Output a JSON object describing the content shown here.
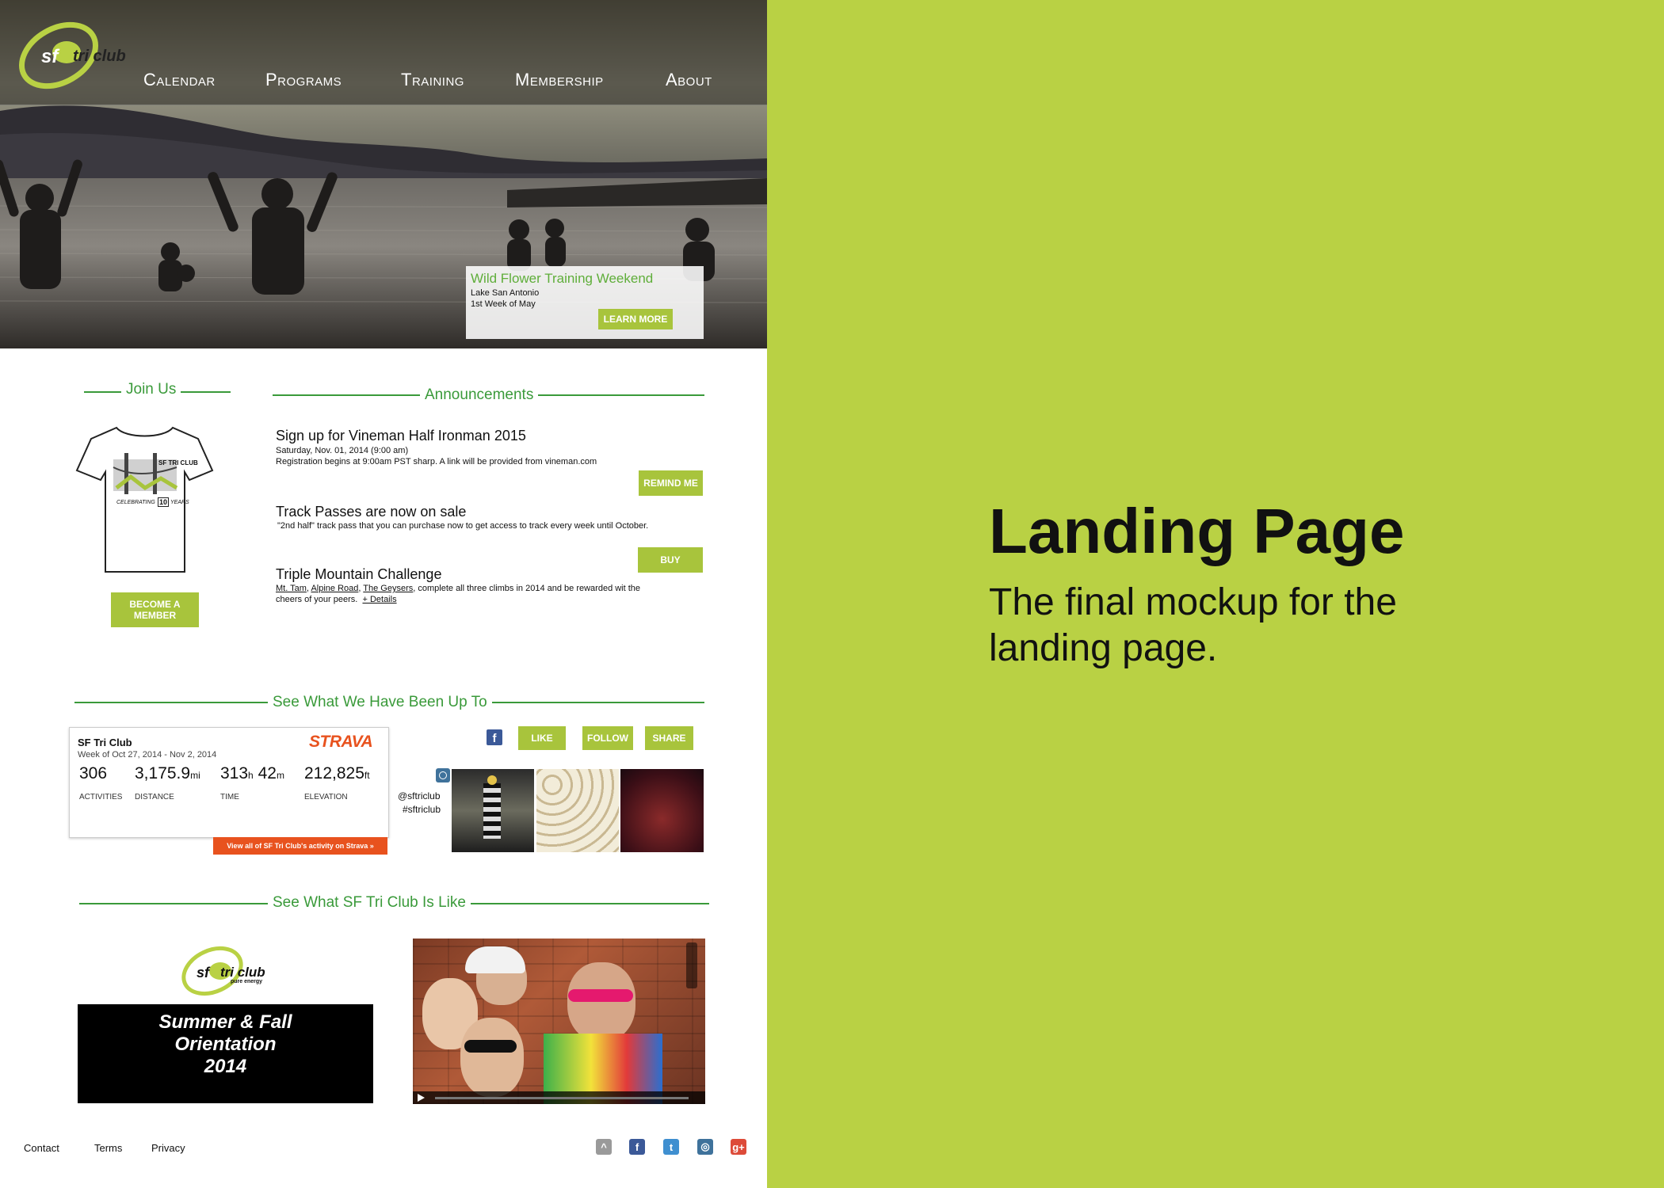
{
  "nav": {
    "logo_text": "tri club",
    "logo_sf": "sf",
    "items": [
      "Calendar",
      "Programs",
      "Training",
      "Membership",
      "About"
    ]
  },
  "hero_card": {
    "title": "Wild Flower Training Weekend",
    "line1": "Lake San Antonio",
    "line2": "1st Week of May",
    "button": "LEARN MORE"
  },
  "join": {
    "title": "Join Us",
    "shirt_title": "SF TRI CLUB",
    "shirt_caption_a": "CELEBRATING",
    "shirt_years": "10",
    "shirt_caption_b": "YEARS",
    "button_line1": "BECOME A",
    "button_line2": "MEMBER"
  },
  "announcements": {
    "title": "Announcements",
    "items": [
      {
        "title": "Sign up for Vineman Half Ironman 2015",
        "line1": "Saturday, Nov. 01, 2014 (9:00 am)",
        "line2": "Registration begins at 9:00am PST sharp. A link will be provided from vineman.com",
        "button": "REMIND ME"
      },
      {
        "title": "Track Passes are now on sale",
        "line1": "\"2nd half\" track pass that you can purchase now to get access to track every week until October.",
        "button": "BUY"
      },
      {
        "title": "Triple Mountain Challenge",
        "link1": "Mt. Tam",
        "link2": "Alpine Road",
        "link3": "The Geysers",
        "line1_rest": ", complete all three climbs in 2014 and be rewarded wit the",
        "line2": "cheers of your peers.",
        "details": "+ Details"
      }
    ]
  },
  "activity": {
    "title": "See What We Have Been Up To",
    "strava": {
      "club": "SF Tri Club",
      "week": "Week of Oct 27, 2014 - Nov 2, 2014",
      "brand": "STRAVA",
      "activities": "306",
      "distance": "3,175.9",
      "distance_unit": "mi",
      "time_h": "313",
      "time_h_unit": "h",
      "time_m": "42",
      "time_m_unit": "m",
      "elevation": "212,825",
      "elevation_unit": "ft",
      "labels": [
        "ACTIVITIES",
        "DISTANCE",
        "TIME",
        "ELEVATION"
      ],
      "link": "View all of SF Tri Club's activity on Strava »"
    },
    "social_buttons": [
      "LIKE",
      "FOLLOW",
      "SHARE"
    ],
    "instagram_handle": "@sftriclub",
    "instagram_tag": "#sftriclub"
  },
  "club": {
    "title": "See What SF Tri Club Is Like",
    "logo_sub": "pure energy",
    "video_line1": "Summer & Fall",
    "video_line2": "Orientation",
    "video_line3": "2014"
  },
  "footer": {
    "links": [
      "Contact",
      "Terms",
      "Privacy"
    ],
    "icons": [
      "strava-icon",
      "facebook-icon",
      "twitter-icon",
      "instagram-icon",
      "google-plus-icon"
    ]
  },
  "panel": {
    "heading": "Landing Page",
    "subtitle_line1": "The final mockup for the",
    "subtitle_line2": "landing page."
  },
  "colors": {
    "accent_green": "#a8c43c",
    "panel_green": "#b9d144",
    "title_green": "#3a9a3a",
    "strava_orange": "#e8521e"
  }
}
